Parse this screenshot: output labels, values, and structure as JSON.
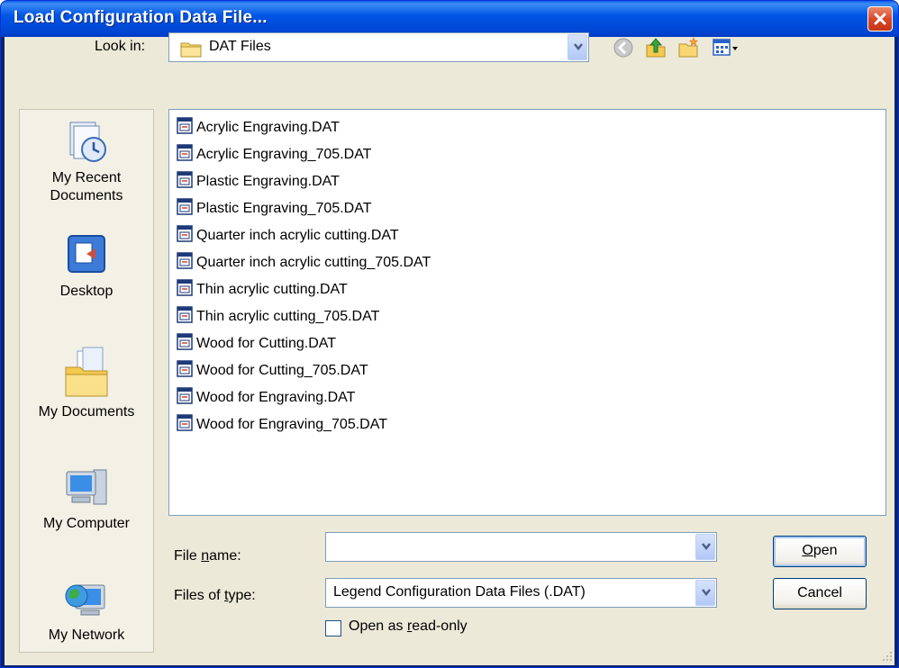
{
  "window": {
    "title": "Load Configuration Data File..."
  },
  "lookin": {
    "label": "Look in:",
    "value": "DAT Files"
  },
  "toolbar": {
    "icons": [
      "back-icon",
      "up-folder-icon",
      "new-folder-icon",
      "views-menu-icon"
    ]
  },
  "places": [
    {
      "label": "My Recent\nDocuments",
      "icon": "recent-documents-icon"
    },
    {
      "label": "Desktop",
      "icon": "desktop-icon"
    },
    {
      "label": "My Documents",
      "icon": "my-documents-icon"
    },
    {
      "label": "My Computer",
      "icon": "my-computer-icon"
    },
    {
      "label": "My Network",
      "icon": "my-network-icon"
    }
  ],
  "files": [
    "Acrylic Engraving.DAT",
    "Acrylic Engraving_705.DAT",
    "Plastic Engraving.DAT",
    "Plastic Engraving_705.DAT",
    "Quarter inch acrylic cutting.DAT",
    "Quarter inch acrylic cutting_705.DAT",
    "Thin acrylic cutting.DAT",
    "Thin acrylic cutting_705.DAT",
    "Wood for Cutting.DAT",
    "Wood for Cutting_705.DAT",
    "Wood for Engraving.DAT",
    "Wood for Engraving_705.DAT"
  ],
  "filename": {
    "label": "File name:",
    "value": ""
  },
  "filetype": {
    "label": "Files of type:",
    "value": "Legend Configuration Data Files (.DAT)"
  },
  "readonly": {
    "label": "Open as read-only",
    "checked": false
  },
  "buttons": {
    "open": "Open",
    "cancel": "Cancel"
  },
  "colors": {
    "titlebar": "#0055e5",
    "face": "#ece9d8",
    "border": "#7f9db9"
  }
}
